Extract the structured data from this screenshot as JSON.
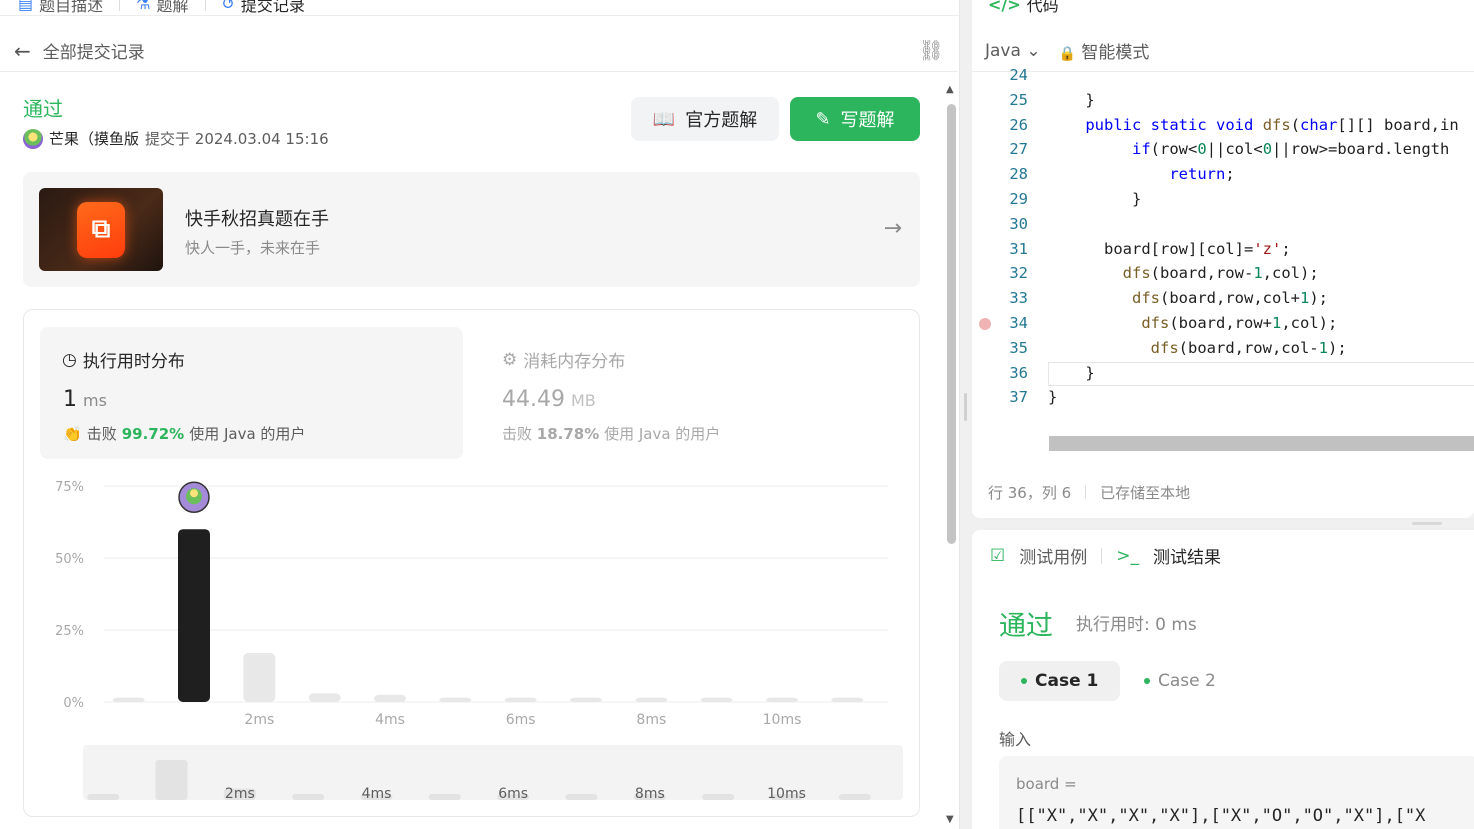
{
  "tabs": [
    "题目描述",
    "题解",
    "提交记录"
  ],
  "back_label": "全部提交记录",
  "status": "通过",
  "user": "芒果（摸鱼版",
  "submitted": "提交于 2024.03.04 15:16",
  "buttons": {
    "official": "官方题解",
    "write": "写题解"
  },
  "banner": {
    "title": "快手秋招真题在手",
    "subtitle": "快人一手，未来在手"
  },
  "runtime": {
    "title": "执行用时分布",
    "value": "1",
    "unit": "ms",
    "beat_prefix": "击败",
    "beat_pct": "99.72%",
    "beat_suffix": "使用 Java 的用户"
  },
  "memory": {
    "title": "消耗内存分布",
    "value": "44.49",
    "unit": "MB",
    "beat_prefix": "击败",
    "beat_pct": "18.78%",
    "beat_suffix": "使用 Java 的用户"
  },
  "chart_data": {
    "type": "bar",
    "categories": [
      "0ms",
      "1ms",
      "2ms",
      "3ms",
      "4ms",
      "5ms",
      "6ms",
      "7ms",
      "8ms",
      "9ms",
      "10ms",
      "11ms"
    ],
    "xticks": [
      "2ms",
      "4ms",
      "6ms",
      "8ms",
      "10ms"
    ],
    "values": [
      1.5,
      60,
      17,
      3,
      2.5,
      1.5,
      1.5,
      1.5,
      1.5,
      1.5,
      1.5,
      1.5
    ],
    "highlight_index": 1,
    "yticks": [
      "75%",
      "50%",
      "25%",
      "0%"
    ],
    "ylim": [
      0,
      75
    ],
    "grid": true
  },
  "minimap_ticks": [
    "2ms",
    "4ms",
    "6ms",
    "8ms",
    "10ms"
  ],
  "editor": {
    "header": "代码",
    "language": "Java",
    "mode": "智能模式",
    "lines": [
      {
        "n": "24",
        "code": ""
      },
      {
        "n": "25",
        "code": "    }"
      },
      {
        "n": "26",
        "code": "    public static void dfs(char[][] board,in"
      },
      {
        "n": "27",
        "code": "         if(row<0||col<0||row>=board.length"
      },
      {
        "n": "28",
        "code": "             return;"
      },
      {
        "n": "29",
        "code": "         }"
      },
      {
        "n": "30",
        "code": ""
      },
      {
        "n": "31",
        "code": "      board[row][col]='z';"
      },
      {
        "n": "32",
        "code": "        dfs(board,row-1,col);"
      },
      {
        "n": "33",
        "code": "         dfs(board,row,col+1);"
      },
      {
        "n": "34",
        "code": "          dfs(board,row+1,col);"
      },
      {
        "n": "35",
        "code": "           dfs(board,row,col-1);"
      },
      {
        "n": "36",
        "code": "    }"
      },
      {
        "n": "37",
        "code": "}"
      }
    ],
    "status_pos": "行 36，列 6",
    "status_saved": "已存储至本地"
  },
  "test": {
    "tab_cases": "测试用例",
    "tab_result": "测试结果",
    "result": "通过",
    "time": "执行用时: 0 ms",
    "case1": "Case 1",
    "case2": "Case 2",
    "input_label": "输入",
    "input_key": "board =",
    "input_value": "[[\"X\",\"X\",\"X\",\"X\"],[\"X\",\"O\",\"O\",\"X\"],[\"X"
  },
  "colors": {
    "accent": "#2db55d",
    "bar": "#1f1f1f",
    "bar_muted": "#e8e8e8"
  }
}
